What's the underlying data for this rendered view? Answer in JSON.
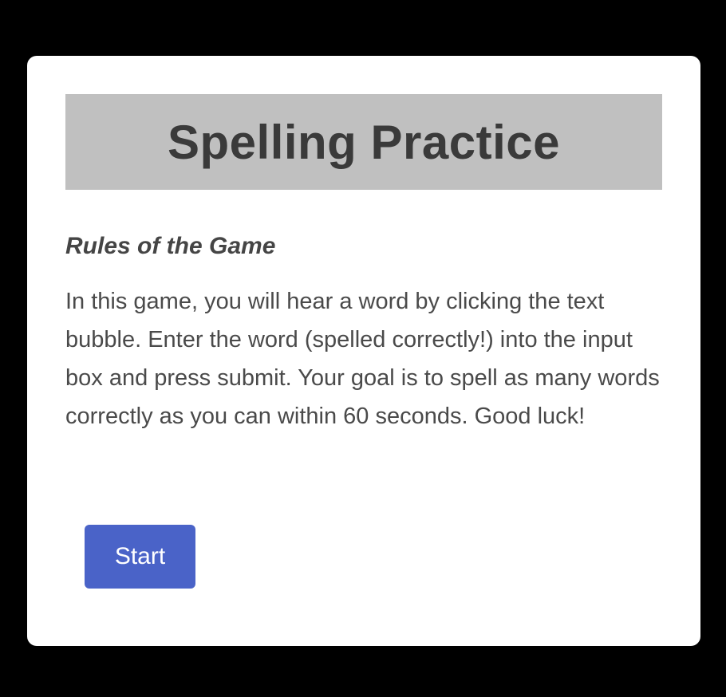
{
  "header": {
    "title": "Spelling Practice"
  },
  "rules": {
    "heading": "Rules of the Game",
    "body": "In this game, you will hear a word by clicking the text bubble. Enter the word (spelled correctly!) into the input box and press submit. Your goal is to spell as many words correctly as you can within 60 seconds. Good luck!"
  },
  "actions": {
    "start_label": "Start"
  },
  "colors": {
    "background": "#000000",
    "card": "#ffffff",
    "banner": "#c0c0c0",
    "title_text": "#3a3a3a",
    "body_text": "#4a4a4a",
    "button": "#4a63c8",
    "button_text": "#ffffff"
  }
}
